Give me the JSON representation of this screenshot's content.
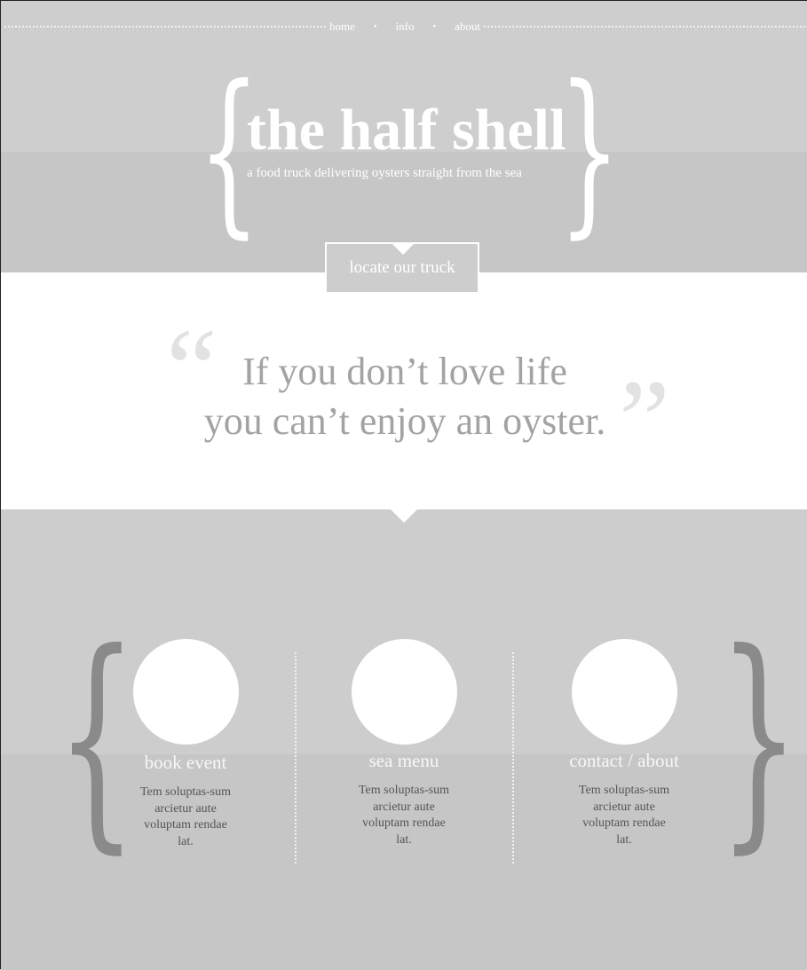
{
  "nav": {
    "items": [
      {
        "label": "home"
      },
      {
        "label": "info"
      },
      {
        "label": "about"
      }
    ],
    "separator": "•"
  },
  "hero": {
    "title": "the half shell",
    "tagline": "a food truck delivering oysters straight from the sea",
    "brace_open": "{",
    "brace_close": "}",
    "cta_label": "locate our truck"
  },
  "quote": {
    "open_mark": "“",
    "close_mark": "”",
    "line1": "If you don’t love life",
    "line2": "you can’t enjoy an oyster."
  },
  "features": {
    "brace_open": "{",
    "brace_close": "}",
    "items": [
      {
        "title": "book event",
        "desc": "Tem soluptas-sum arcietur aute voluptam rendae lat."
      },
      {
        "title": "sea menu",
        "desc": "Tem soluptas-sum arcietur aute voluptam rendae lat."
      },
      {
        "title": "contact / about",
        "desc": "Tem soluptas-sum arcietur aute voluptam rendae lat."
      }
    ]
  },
  "colors": {
    "band_light": "#cecece",
    "band_dark": "#c6c6c6",
    "quote_text": "#a3a3a3",
    "quote_marks": "#e2e2e2",
    "brace_dark": "#8a8a8a",
    "body_text": "#555555"
  }
}
